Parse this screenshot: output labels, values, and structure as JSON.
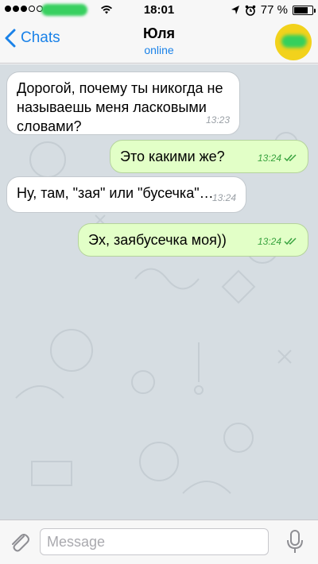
{
  "status_bar": {
    "time": "18:01",
    "battery": "77 %",
    "battery_level": 0.77
  },
  "header": {
    "back_label": "Chats",
    "contact_name": "Юля",
    "contact_status": "online"
  },
  "messages": [
    {
      "direction": "in",
      "text_lines": [
        "Дорогой, почему ты никогда не",
        "называешь меня ласковыми",
        "словами?"
      ],
      "time": "13:23"
    },
    {
      "direction": "out",
      "text_lines": [
        "Это какими же?"
      ],
      "time": "13:24",
      "read": true
    },
    {
      "direction": "in",
      "text_lines": [
        "Ну, там, \"зая\" или \"бусечка\"…"
      ],
      "time": "13:24"
    },
    {
      "direction": "out",
      "text_lines": [
        "Эх, заябусечка моя))"
      ],
      "time": "13:24",
      "read": true
    }
  ],
  "input": {
    "placeholder": "Message"
  },
  "icons": {
    "back": "chevron-left-icon",
    "attach": "paperclip-icon",
    "mic": "microphone-icon",
    "read": "double-check-icon"
  },
  "colors": {
    "accent": "#1a82e8",
    "outgoing_bubble": "#e2ffc7",
    "incoming_bubble": "#ffffff",
    "read_check": "#39a33f"
  }
}
